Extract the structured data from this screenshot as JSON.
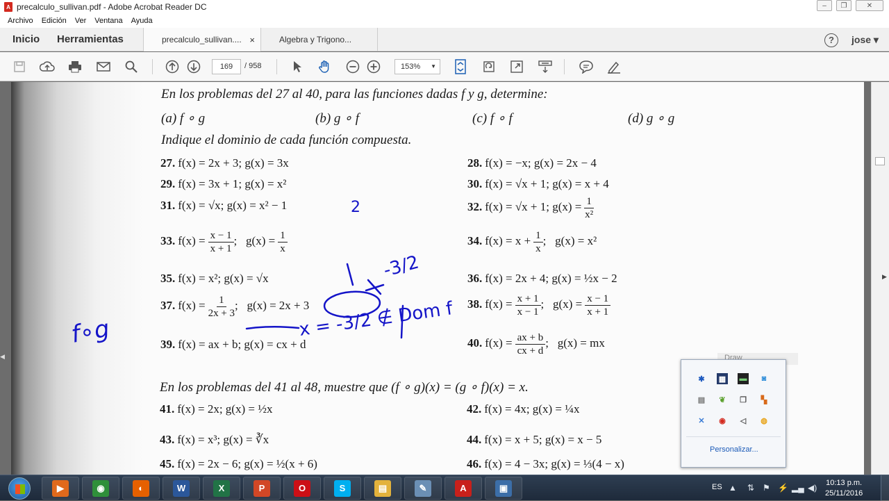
{
  "window": {
    "title": "precalculo_sullivan.pdf - Adobe Acrobat Reader DC"
  },
  "menu": [
    "Archivo",
    "Edición",
    "Ver",
    "Ventana",
    "Ayuda"
  ],
  "nav": {
    "home": "Inicio",
    "tools": "Herramientas"
  },
  "tabs": [
    {
      "label": "precalculo_sullivan....",
      "close": "×"
    },
    {
      "label": "Algebra y Trigono..."
    }
  ],
  "user": {
    "help": "?",
    "name": "jose ▾"
  },
  "toolbar": {
    "page": "169",
    "total": "/ 958",
    "zoom": "153%"
  },
  "document": {
    "heading1": "En los problemas del 27 al 40, para las funciones dadas f y g, determine:",
    "parts": [
      "(a)  f ∘ g",
      "(b)  g ∘ f",
      "(c)  f ∘ f",
      "(d)  g ∘ g"
    ],
    "heading2": "Indique el dominio de cada función compuesta.",
    "heading3": "En los problemas del 41 al 48, muestre que (f ∘ g)(x) = (g ∘ f)(x) = x.",
    "problems": [
      {
        "num": "27.",
        "text": "f(x) = 2x + 3;   g(x) = 3x"
      },
      {
        "num": "28.",
        "text": "f(x) = −x;   g(x) = 2x − 4"
      },
      {
        "num": "29.",
        "text": "f(x) = 3x + 1;   g(x) = x²"
      },
      {
        "num": "30.",
        "text": "f(x) = √x + 1;   g(x) = x + 4"
      },
      {
        "num": "31.",
        "text": "f(x) = √x;   g(x) = x² − 1"
      },
      {
        "num": "32.",
        "text": "f(x) = √x + 1;   g(x) ="
      },
      {
        "num": "33.",
        "text": "f(x) ="
      },
      {
        "num": "34.",
        "text": "f(x) = x +"
      },
      {
        "num": "35.",
        "text": "f(x) = x²;   g(x) = √x"
      },
      {
        "num": "36.",
        "text": "f(x) = 2x + 4;   g(x) = ½x − 2"
      },
      {
        "num": "37.",
        "text": "f(x) ="
      },
      {
        "num": "38.",
        "text": "f(x) ="
      },
      {
        "num": "39.",
        "text": "f(x) = ax + b;   g(x) = cx + d"
      },
      {
        "num": "40.",
        "text": "f(x) ="
      },
      {
        "num": "41.",
        "text": "f(x) = 2x;   g(x) = ½x"
      },
      {
        "num": "42.",
        "text": "f(x) = 4x;   g(x) = ¼x"
      },
      {
        "num": "43.",
        "text": "f(x) = x³;   g(x) = ∛x"
      },
      {
        "num": "44.",
        "text": "f(x) = x + 5;   g(x) = x − 5"
      },
      {
        "num": "45.",
        "text": "f(x) = 2x − 6;   g(x) = ½(x + 6)"
      },
      {
        "num": "46.",
        "text": "f(x) = 4 − 3x;   g(x) = ⅓(4 − x)"
      }
    ],
    "fractions": {
      "one": "1",
      "x2": "x²",
      "x": "x",
      "xm1": "x − 1",
      "xp1": "x + 1",
      "twoxp3": "2x + 3",
      "axpb": "ax + b",
      "cxpd": "cx + d",
      "g33": "g(x) =",
      "g34": "g(x) = x²",
      "g37": "g(x) =",
      "g38": "g(x) =",
      "g40": "g(x) = mx"
    }
  },
  "ink": {
    "fog": "f∘g",
    "two": "2",
    "one": "1",
    "neg32": "-3/2",
    "x_eq": "x = -3/2 ∉ Dom f",
    "boxed": "2x + 3"
  },
  "tray_popup": {
    "title": "Draw",
    "customize": "Personalizar..."
  },
  "taskbar": {
    "lang": "ES",
    "time": "10:13 p.m.",
    "date": "25/11/2016",
    "apps": [
      {
        "name": "media-player",
        "letter": "▶",
        "color": "#e0691c"
      },
      {
        "name": "chrome",
        "letter": "◉",
        "color": "#2f8f3a"
      },
      {
        "name": "firefox",
        "letter": "◐",
        "color": "#e66000"
      },
      {
        "name": "word",
        "letter": "W",
        "color": "#2b579a"
      },
      {
        "name": "excel",
        "letter": "X",
        "color": "#217346"
      },
      {
        "name": "powerpoint",
        "letter": "P",
        "color": "#d24726"
      },
      {
        "name": "opera",
        "letter": "O",
        "color": "#cc0f16"
      },
      {
        "name": "skype",
        "letter": "S",
        "color": "#00aff0"
      },
      {
        "name": "file-explorer",
        "letter": "▤",
        "color": "#e3b23c"
      },
      {
        "name": "paint",
        "letter": "✎",
        "color": "#6b8fb5"
      },
      {
        "name": "acrobat",
        "letter": "A",
        "color": "#c8201b"
      },
      {
        "name": "screen-app",
        "letter": "▣",
        "color": "#3c6ea8"
      }
    ]
  },
  "colors": {
    "ink": "#1414c8",
    "acrobat_red": "#d32a1f",
    "link_blue": "#1c5bb8"
  }
}
